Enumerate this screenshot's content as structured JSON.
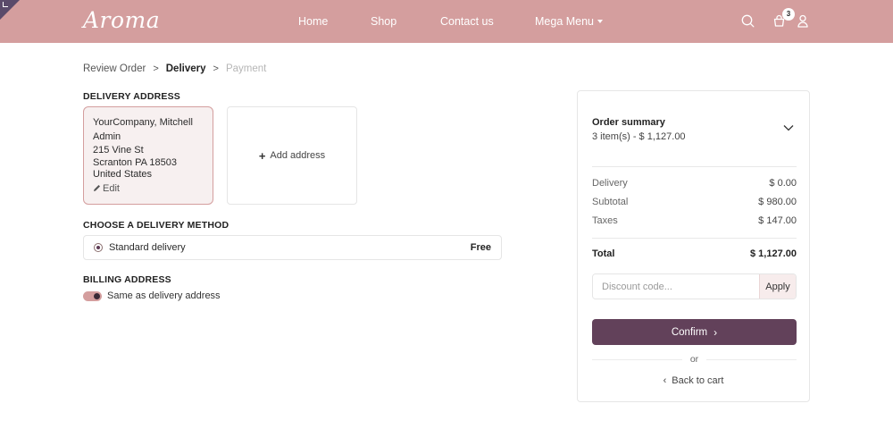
{
  "header": {
    "logo": "Aroma",
    "nav": [
      "Home",
      "Shop",
      "Contact us",
      "Mega Menu"
    ],
    "cart_count": "3",
    "icons": [
      "search-icon",
      "cart-icon",
      "user-icon"
    ]
  },
  "breadcrumb": {
    "review": "Review Order",
    "delivery": "Delivery",
    "payment": "Payment",
    "sep": ">"
  },
  "delivery_address": {
    "title": "DELIVERY ADDRESS",
    "lines": [
      "YourCompany, Mitchell",
      "Admin",
      "215 Vine St",
      "Scranton PA 18503",
      "United States"
    ],
    "edit_label": "Edit",
    "add_label": "Add address"
  },
  "delivery_method": {
    "title": "CHOOSE A DELIVERY METHOD",
    "name": "Standard delivery",
    "price": "Free"
  },
  "billing": {
    "title": "BILLING ADDRESS",
    "same_label": "Same as delivery address"
  },
  "summary": {
    "title": "Order summary",
    "subtitle": "3 item(s) -  $ 1,127.00",
    "rows": [
      {
        "label": "Delivery",
        "value": "$ 0.00"
      },
      {
        "label": "Subtotal",
        "value": "$ 980.00"
      },
      {
        "label": "Taxes",
        "value": "$ 147.00"
      }
    ],
    "total_label": "Total",
    "total_value": "$ 1,127.00",
    "discount_placeholder": "Discount code...",
    "apply_label": "Apply",
    "confirm_label": "Confirm",
    "or_label": "or",
    "back_label": "Back to cart"
  },
  "colors": {
    "header_bg": "#d49e9e",
    "confirm_bg": "#62415a",
    "card_bg": "#f7f0f0"
  }
}
